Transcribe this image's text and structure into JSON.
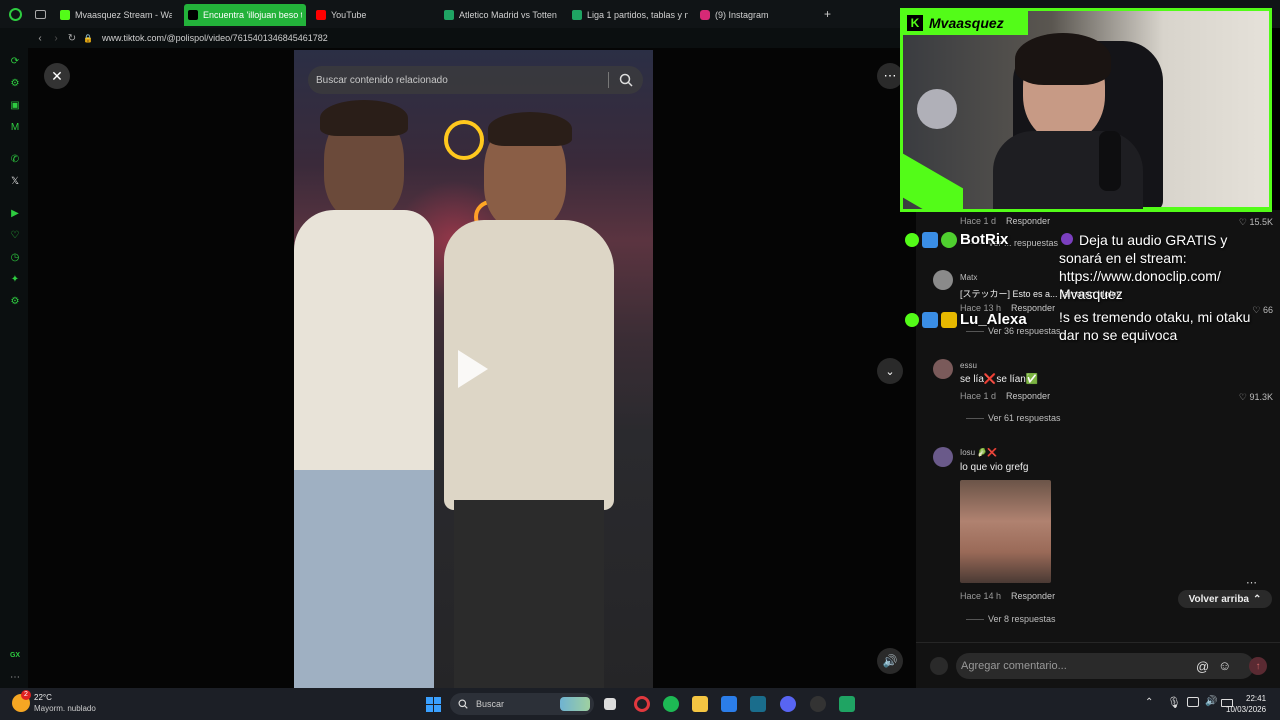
{
  "tabs": [
    {
      "label": "Mvaasquez Stream - Watc",
      "color": "#53fc18",
      "active": false
    },
    {
      "label": "Encuentra 'illojuan beso t",
      "color": "#000000",
      "active": true
    },
    {
      "label": "YouTube",
      "color": "#ff0000",
      "active": false
    },
    {
      "label": "Atletico Madrid vs Totten",
      "color": "#1fa463",
      "active": false
    },
    {
      "label": "Liga 1 partidos, tablas y n",
      "color": "#1fa463",
      "active": false
    },
    {
      "label": "(9) Instagram",
      "color": "#d62976",
      "active": false
    }
  ],
  "new_tab_symbol": "+",
  "address": {
    "url": "www.tiktok.com/@polispol/video/7615401346845461782"
  },
  "video": {
    "search_placeholder": "Buscar contenido relacionado"
  },
  "stream": {
    "channel_name": "Mvaasquez",
    "chat": [
      {
        "user": "BotRix",
        "message": "Deja tu audio GRATIS y sonará en el stream: https://www.donoclip.com/ Mvasquez"
      },
      {
        "user": "Lu_Alexa",
        "message": "!s es tremendo otaku, mi otaku dar no se equivoca"
      }
    ]
  },
  "comments": {
    "top_partial": {
      "meta": "Hace 1 d",
      "reply": "Responder",
      "likes": "15.5K",
      "replies_label": "Ver ... respuestas"
    },
    "items": [
      {
        "user": "Matx",
        "text": "[ステッカー] Esto es a... llamaran ídolos",
        "time": "Hace 13 h",
        "reply": "Responder",
        "likes": "66",
        "replies": "Ver 36 respuestas"
      },
      {
        "user": "essu",
        "text": "se lía❌se lían✅",
        "time": "Hace 1 d",
        "reply": "Responder",
        "likes": "91.3K",
        "replies": "Ver 61 respuestas"
      },
      {
        "user": "Iosu 🥬❌",
        "text": "lo que vio grefg",
        "time": "Hace 14 h",
        "reply": "Responder",
        "likes": "",
        "replies": "Ver 8 respuestas"
      }
    ],
    "back_to_top": "Volver arriba",
    "input_placeholder": "Agregar comentario..."
  },
  "taskbar": {
    "weather_temp": "22°C",
    "weather_desc": "Mayorm. nublado",
    "weather_badge": "2",
    "search_label": "Buscar",
    "time": "22:41",
    "date": "10/03/2026"
  },
  "colors": {
    "kick_green": "#53fc18",
    "opera_green": "#23b23a",
    "like_red": "#fe2c55"
  }
}
